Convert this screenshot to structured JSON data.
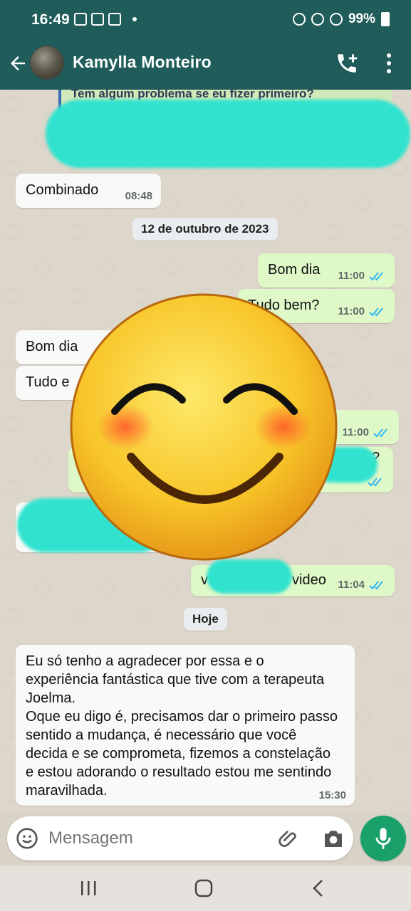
{
  "status_bar": {
    "time": "16:49",
    "battery_percent": "99%"
  },
  "header": {
    "contact_name": "Kamylla Monteiro"
  },
  "chat": {
    "quoted_text": "Tem algum problema se eu fizer primeiro?",
    "messages": [
      {
        "id": "m1",
        "text": "Combinado",
        "time": "08:48",
        "direction": "in"
      },
      {
        "id": "m2",
        "text": "Bom dia",
        "time": "11:00",
        "direction": "out"
      },
      {
        "id": "m3",
        "text": "Tudo bem?",
        "time": "11:00",
        "direction": "out"
      },
      {
        "id": "m4",
        "text": "Bom dia",
        "time": "",
        "direction": "in"
      },
      {
        "id": "m5",
        "text": "Tudo e",
        "time": "",
        "direction": "in"
      },
      {
        "id": "m6",
        "text": "",
        "time": "11:00",
        "direction": "out"
      },
      {
        "id": "m7",
        "text": "?",
        "time": "",
        "direction": "out"
      },
      {
        "id": "m8",
        "text": "v",
        "time": "11:04",
        "direction": "out",
        "text_end": "video"
      }
    ],
    "date_chips": [
      "12 de outubro de 2023",
      "Hoje"
    ],
    "long_message": {
      "text": "Eu só tenho a agradecer por essa e o experiência fantástica que tive com a terapeuta Joelma.\nOque eu digo é, precisamos dar o primeiro passo sentido a mudança, é necessário que você decida e se comprometa, fizemos a constelação e estou adorando o resultado estou me sentindo maravilhada.",
      "time": "15:30"
    }
  },
  "input": {
    "placeholder": "Mensagem"
  },
  "colors": {
    "header": "#1f5c5a",
    "outgoing": "#dff8c8",
    "incoming": "#f9f9f7",
    "mic": "#1aa16b",
    "ticks": "#34b7f1"
  },
  "icons": [
    "back-arrow-icon",
    "add-call-icon",
    "more-vert-icon",
    "emoji-icon",
    "attach-icon",
    "camera-icon",
    "mic-icon",
    "nav-recents-icon",
    "nav-home-icon",
    "nav-back-icon"
  ]
}
